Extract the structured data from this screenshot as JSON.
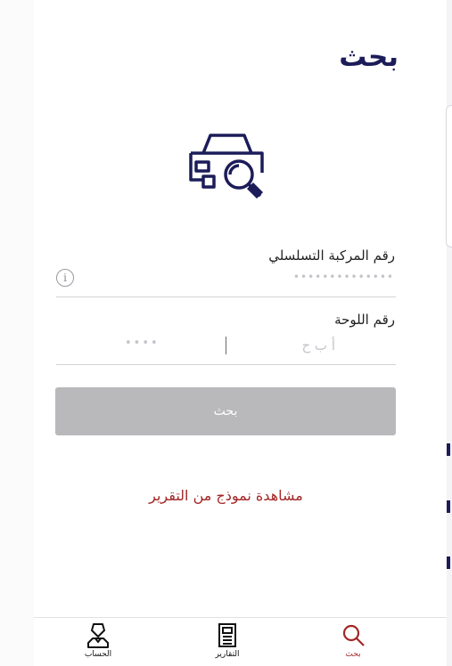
{
  "page": {
    "title": "بحث"
  },
  "form": {
    "vin_label": "رقم المركبة التسلسلي",
    "vin_placeholder": "••••••••••••••",
    "vin_info_icon": "info-icon",
    "plate_label": "رقم اللوحة",
    "plate_letters_placeholder": "أ ب ح",
    "plate_numbers_placeholder": "••••",
    "search_button_label": "بحث"
  },
  "links": {
    "sample_report": "مشاهدة نموذج من التقرير"
  },
  "tabbar": {
    "items": [
      {
        "label": "الحساب",
        "icon": "user-icon"
      },
      {
        "label": "التقارير",
        "icon": "document-icon"
      },
      {
        "label": "بحث",
        "icon": "search-icon",
        "active": true
      }
    ]
  },
  "colors": {
    "primary": "#1c1c5a",
    "accent": "#a32626",
    "button_disabled": "#b9b9bc"
  }
}
